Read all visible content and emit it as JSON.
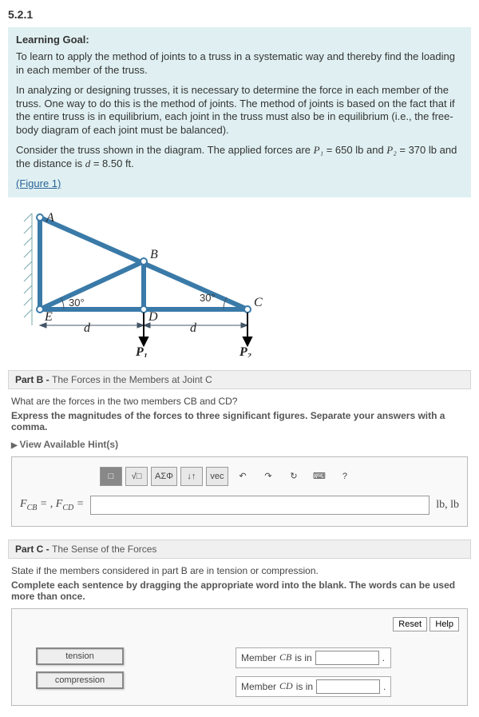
{
  "section_number": "5.2.1",
  "goal": {
    "heading": "Learning Goal:",
    "text1": "To learn to apply the method of joints to a truss in a systematic way and thereby find the loading in each member of the truss.",
    "text2": "In analyzing or designing trusses, it is necessary to determine the force in each member of the truss. One way to do this is the method of joints. The method of joints is based on the fact that if the entire truss is in equilibrium, each joint in the truss must also be in equilibrium (i.e., the free-body diagram of each joint must be balanced).",
    "text3_pre": "Consider the truss shown in the diagram. The applied forces are ",
    "p1_sym": "P₁",
    "p1_val": " = 650 lb",
    "and": " and ",
    "p2_sym": "P₂",
    "p2_val": " = 370 lb",
    "dist_pre": " and the distance is ",
    "d_sym": "d",
    "d_val": " = 8.50 ft",
    "period": ".",
    "figure_link": "(Figure 1)"
  },
  "figure": {
    "labels": {
      "A": "A",
      "B": "B",
      "C": "C",
      "D": "D",
      "E": "E",
      "ang1": "30°",
      "ang2": "30°",
      "d": "d",
      "P1": "P₁",
      "P2": "P₂"
    }
  },
  "partB": {
    "header_bold": "Part B - ",
    "header_rest": "The Forces in the Members at Joint C",
    "question": "What are the forces in the two members CB and CD?",
    "instruction": "Express the magnitudes of the forces to three significant figures. Separate your answers with a comma.",
    "hints": "View Available Hint(s)",
    "toolbar": {
      "t1": "□",
      "t2": "√□",
      "t3": "ΑΣΦ",
      "t4": "↓↑",
      "t5": "vec",
      "t6": "↶",
      "t7": "↷",
      "t8": "↻",
      "t9": "⌨",
      "t10": "?"
    },
    "label_lhs": "F",
    "label_cb": "CB",
    "eq": " = ",
    "comma": ", ",
    "label_cd": "CD",
    "input_value": "",
    "units": "lb, lb"
  },
  "partC": {
    "header_bold": "Part C - ",
    "header_rest": "The Sense of the Forces",
    "line1": "State if the members considered in part B are in tension or compression.",
    "instruction": "Complete each sentence by dragging the appropriate word into the blank. The words can be used more than once.",
    "reset": "Reset",
    "help": "Help",
    "words": {
      "w1": "tension",
      "w2": "compression"
    },
    "s1_pre": "Member ",
    "s1_mid": "CB",
    "s1_post": " is in ",
    "s2_pre": "Member ",
    "s2_mid": "CD",
    "s2_post": " is in ",
    "tail": "."
  }
}
